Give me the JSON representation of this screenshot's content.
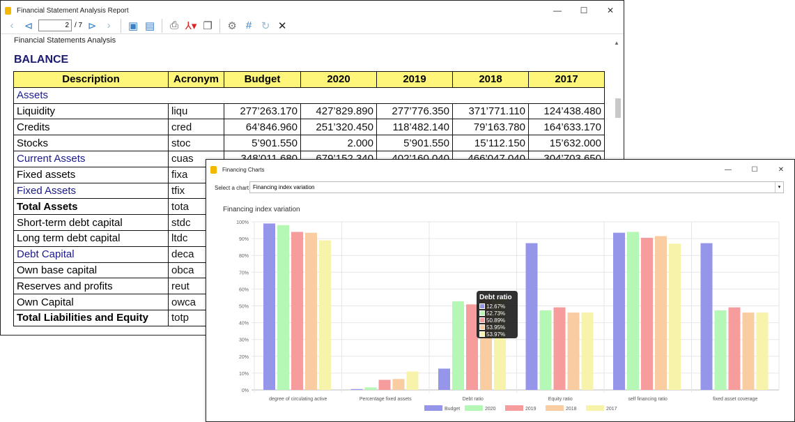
{
  "report": {
    "title": "Financial Statement Analysis Report",
    "page": "2",
    "page_total": "/ 7",
    "subtitle": "Financial Statements Analysis",
    "heading": "BALANCE",
    "columns": [
      "Description",
      "Acronym",
      "Budget",
      "2020",
      "2019",
      "2018",
      "2017"
    ],
    "rows": [
      {
        "desc": "Assets",
        "acr": "",
        "vals": [
          "",
          "",
          "",
          "",
          ""
        ],
        "style": "blue"
      },
      {
        "desc": "Liquidity",
        "acr": "liqu",
        "vals": [
          "277’263.170",
          "427’829.890",
          "277’776.350",
          "371’771.110",
          "124’438.480"
        ],
        "style": ""
      },
      {
        "desc": "Credits",
        "acr": "cred",
        "vals": [
          "64’846.960",
          "251’320.450",
          "118’482.140",
          "79’163.780",
          "164’633.170"
        ],
        "style": ""
      },
      {
        "desc": "Stocks",
        "acr": "stoc",
        "vals": [
          "5’901.550",
          "2.000",
          "5’901.550",
          "15’112.150",
          "15’632.000"
        ],
        "style": ""
      },
      {
        "desc": "Current Assets",
        "acr": "cuas",
        "vals": [
          "348’011.680",
          "679’152.340",
          "402’160.040",
          "466’047.040",
          "304’703.650"
        ],
        "style": "blue"
      },
      {
        "desc": "Fixed assets",
        "acr": "fixa",
        "vals": [
          "",
          "",
          "",
          "",
          ""
        ],
        "style": ""
      },
      {
        "desc": "Fixed Assets",
        "acr": "tfix",
        "vals": [
          "",
          "",
          "",
          "",
          ""
        ],
        "style": "blue"
      },
      {
        "desc": "Total Assets",
        "acr": "tota",
        "vals": [
          "",
          "",
          "",
          "",
          ""
        ],
        "style": "bold"
      },
      {
        "desc": "Short-term debt capital",
        "acr": "stdc",
        "vals": [
          "",
          "",
          "",
          "",
          ""
        ],
        "style": ""
      },
      {
        "desc": "Long term debt capital",
        "acr": "ltdc",
        "vals": [
          "",
          "",
          "",
          "",
          ""
        ],
        "style": ""
      },
      {
        "desc": "Debt Capital",
        "acr": "deca",
        "vals": [
          "",
          "",
          "",
          "",
          ""
        ],
        "style": "blue"
      },
      {
        "desc": "Own base capital",
        "acr": "obca",
        "vals": [
          "",
          "",
          "",
          "",
          ""
        ],
        "style": ""
      },
      {
        "desc": "Reserves and profits",
        "acr": "reut",
        "vals": [
          "",
          "",
          "",
          "",
          ""
        ],
        "style": ""
      },
      {
        "desc": "Own Capital",
        "acr": "owca",
        "vals": [
          "",
          "",
          "",
          "",
          ""
        ],
        "style": ""
      },
      {
        "desc": "Total Liabilities and Equity",
        "acr": "totp",
        "vals": [
          "",
          "",
          "",
          "",
          ""
        ],
        "style": "bold"
      }
    ]
  },
  "charts_window": {
    "title": "Financing Charts",
    "select_label": "Select a chart",
    "select_value": "Financing index variation"
  },
  "chart_data": {
    "type": "bar",
    "title": "Financing index variation",
    "ylim": [
      0,
      100
    ],
    "yticks": [
      "0%",
      "10%",
      "20%",
      "30%",
      "40%",
      "50%",
      "60%",
      "70%",
      "80%",
      "90%",
      "100%"
    ],
    "grid": true,
    "legend": "bottom",
    "categories": [
      "degree of circulating active",
      "Percentage fixed assets",
      "Debt ratio",
      "Equity ratio",
      "self financing ratio",
      "fixed asset coverage"
    ],
    "series": [
      {
        "name": "Budget",
        "color": "#9595ea",
        "values": [
          99,
          0.5,
          12.67,
          87.3,
          93.5,
          87.3
        ]
      },
      {
        "name": "2020",
        "color": "#b5f7b5",
        "values": [
          98,
          1.5,
          52.73,
          47.3,
          94,
          47.3
        ]
      },
      {
        "name": "2019",
        "color": "#f79c9c",
        "values": [
          94,
          6,
          50.89,
          49.1,
          90.5,
          49.1
        ]
      },
      {
        "name": "2018",
        "color": "#f9cca2",
        "values": [
          93.5,
          6.5,
          53.95,
          46,
          91.5,
          46
        ]
      },
      {
        "name": "2017",
        "color": "#f7f3ab",
        "values": [
          89,
          11,
          53.97,
          46,
          87,
          46
        ]
      }
    ],
    "tooltip": {
      "title": "Debt ratio",
      "values": [
        "12.67%",
        "52.73%",
        "50.89%",
        "53.95%",
        "53.97%"
      ]
    }
  }
}
